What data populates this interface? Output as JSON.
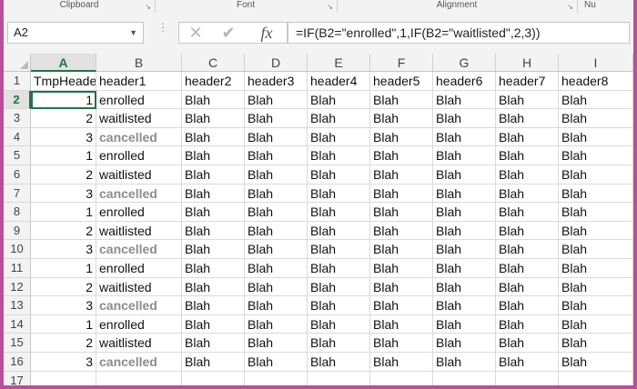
{
  "ribbon": {
    "groups": [
      {
        "label": "Clipboard"
      },
      {
        "label": "Font"
      },
      {
        "label": "Alignment"
      },
      {
        "label": "Nu"
      }
    ]
  },
  "formula_bar": {
    "name_box": "A2",
    "cancel_icon": "close-icon",
    "enter_icon": "check-icon",
    "fx_label": "fx",
    "formula": "=IF(B2=\"enrolled\",1,IF(B2=\"waitlisted\",2,3))"
  },
  "sheet": {
    "columns": [
      "A",
      "B",
      "C",
      "D",
      "E",
      "F",
      "G",
      "H",
      "I"
    ],
    "active_column": "A",
    "active_row": "2",
    "rows": [
      {
        "n": "1",
        "cells": [
          "TmpHeade",
          "header1",
          "header2",
          "header3",
          "header4",
          "header5",
          "header6",
          "header7",
          "header8"
        ]
      },
      {
        "n": "2",
        "cells": [
          "1",
          "enrolled",
          "Blah",
          "Blah",
          "Blah",
          "Blah",
          "Blah",
          "Blah",
          "Blah"
        ]
      },
      {
        "n": "3",
        "cells": [
          "2",
          "waitlisted",
          "Blah",
          "Blah",
          "Blah",
          "Blah",
          "Blah",
          "Blah",
          "Blah"
        ]
      },
      {
        "n": "4",
        "cells": [
          "3",
          "cancelled",
          "Blah",
          "Blah",
          "Blah",
          "Blah",
          "Blah",
          "Blah",
          "Blah"
        ]
      },
      {
        "n": "5",
        "cells": [
          "1",
          "enrolled",
          "Blah",
          "Blah",
          "Blah",
          "Blah",
          "Blah",
          "Blah",
          "Blah"
        ]
      },
      {
        "n": "6",
        "cells": [
          "2",
          "waitlisted",
          "Blah",
          "Blah",
          "Blah",
          "Blah",
          "Blah",
          "Blah",
          "Blah"
        ]
      },
      {
        "n": "7",
        "cells": [
          "3",
          "cancelled",
          "Blah",
          "Blah",
          "Blah",
          "Blah",
          "Blah",
          "Blah",
          "Blah"
        ]
      },
      {
        "n": "8",
        "cells": [
          "1",
          "enrolled",
          "Blah",
          "Blah",
          "Blah",
          "Blah",
          "Blah",
          "Blah",
          "Blah"
        ]
      },
      {
        "n": "9",
        "cells": [
          "2",
          "waitlisted",
          "Blah",
          "Blah",
          "Blah",
          "Blah",
          "Blah",
          "Blah",
          "Blah"
        ]
      },
      {
        "n": "10",
        "cells": [
          "3",
          "cancelled",
          "Blah",
          "Blah",
          "Blah",
          "Blah",
          "Blah",
          "Blah",
          "Blah"
        ]
      },
      {
        "n": "11",
        "cells": [
          "1",
          "enrolled",
          "Blah",
          "Blah",
          "Blah",
          "Blah",
          "Blah",
          "Blah",
          "Blah"
        ]
      },
      {
        "n": "12",
        "cells": [
          "2",
          "waitlisted",
          "Blah",
          "Blah",
          "Blah",
          "Blah",
          "Blah",
          "Blah",
          "Blah"
        ]
      },
      {
        "n": "13",
        "cells": [
          "3",
          "cancelled",
          "Blah",
          "Blah",
          "Blah",
          "Blah",
          "Blah",
          "Blah",
          "Blah"
        ]
      },
      {
        "n": "14",
        "cells": [
          "1",
          "enrolled",
          "Blah",
          "Blah",
          "Blah",
          "Blah",
          "Blah",
          "Blah",
          "Blah"
        ]
      },
      {
        "n": "15",
        "cells": [
          "2",
          "waitlisted",
          "Blah",
          "Blah",
          "Blah",
          "Blah",
          "Blah",
          "Blah",
          "Blah"
        ]
      },
      {
        "n": "16",
        "cells": [
          "3",
          "cancelled",
          "Blah",
          "Blah",
          "Blah",
          "Blah",
          "Blah",
          "Blah",
          "Blah"
        ]
      },
      {
        "n": "17",
        "cells": [
          "",
          "",
          "",
          "",
          "",
          "",
          "",
          "",
          ""
        ]
      }
    ]
  },
  "colors": {
    "frame": "#b94f9a",
    "accent": "#217346",
    "cancelled_text": "#8c8c8c"
  }
}
